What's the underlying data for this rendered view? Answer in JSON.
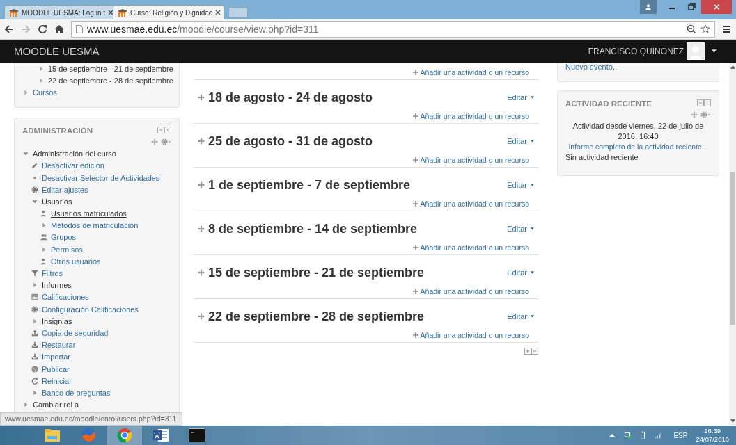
{
  "browser": {
    "tabs": [
      {
        "title": "MOODLE UESMA: Log in t",
        "selected": false
      },
      {
        "title": "Curso: Religión y Dignidac",
        "selected": true
      }
    ],
    "url_host": "www.uesmae.edu.ec",
    "url_path": "/moodle/course/view.php?id=311"
  },
  "navbar": {
    "brand": "MOODLE UESMA",
    "user": "FRANCISCO QUIÑONEZ"
  },
  "nav_block": {
    "weeks": [
      "15 de septiembre - 21 de septiembre",
      "22 de septiembre - 28 de septiembre"
    ],
    "courses_link": "Cursos"
  },
  "admin": {
    "title": "ADMINISTRACIÓN",
    "tree": [
      {
        "label": "Administración del curso",
        "kind": "branch",
        "link": false,
        "expanded": true,
        "children": [
          {
            "label": "Desactivar edición",
            "kind": "edit"
          },
          {
            "label": "Desactivar Selector de Actividades",
            "kind": "bullet"
          },
          {
            "label": "Editar ajustes",
            "kind": "settings"
          },
          {
            "label": "Usuarios",
            "kind": "branch",
            "link": false,
            "expanded": true,
            "children": [
              {
                "label": "Usuarios matriculados",
                "kind": "user",
                "selected": true
              },
              {
                "label": "Métodos de matriculación",
                "kind": "branch",
                "link": true,
                "expanded": false
              },
              {
                "label": "Grupos",
                "kind": "group",
                "selected": false
              },
              {
                "label": "Permisos",
                "kind": "branch",
                "link": true,
                "expanded": false
              },
              {
                "label": "Otros usuarios",
                "kind": "user",
                "selected": false
              }
            ]
          },
          {
            "label": "Filtros",
            "kind": "filter"
          },
          {
            "label": "Informes",
            "kind": "branch",
            "link": false,
            "expanded": false
          },
          {
            "label": "Calificaciones",
            "kind": "grades"
          },
          {
            "label": "Configuración Calificaciones",
            "kind": "settings"
          },
          {
            "label": "Insignias",
            "kind": "branch",
            "link": false,
            "expanded": false
          },
          {
            "label": "Copia de seguridad",
            "kind": "backup"
          },
          {
            "label": "Restaurar",
            "kind": "restore"
          },
          {
            "label": "Importar",
            "kind": "restore"
          },
          {
            "label": "Publicar",
            "kind": "publish"
          },
          {
            "label": "Reiniciar",
            "kind": "reset"
          },
          {
            "label": "Banco de preguntas",
            "kind": "branch",
            "link": true,
            "expanded": false
          }
        ]
      },
      {
        "label": "Cambiar rol a",
        "kind": "branch",
        "link": false,
        "expanded": false
      }
    ]
  },
  "course": {
    "top_add_link": "Añadir una actividad o un recurso",
    "sections": [
      {
        "title": "18 de agosto - 24 de agosto",
        "edit": "Editar",
        "add": "Añadir una actividad o un recurso"
      },
      {
        "title": "25 de agosto - 31 de agosto",
        "edit": "Editar",
        "add": "Añadir una actividad o un recurso"
      },
      {
        "title": "1 de septiembre - 7 de septiembre",
        "edit": "Editar",
        "add": "Añadir una actividad o un recurso"
      },
      {
        "title": "8 de septiembre - 14 de septiembre",
        "edit": "Editar",
        "add": "Añadir una actividad o un recurso"
      },
      {
        "title": "15 de septiembre - 21 de septiembre",
        "edit": "Editar",
        "add": "Añadir una actividad o un recurso"
      },
      {
        "title": "22 de septiembre - 28 de septiembre",
        "edit": "Editar",
        "add": "Añadir una actividad o un recurso"
      }
    ]
  },
  "calendar_block": {
    "new_event_link": "Nuevo evento..."
  },
  "recent": {
    "title": "ACTIVIDAD RECIENTE",
    "since": "Actividad desde viernes, 22 de julio de 2016, 16:40",
    "report_link": "Informe completo de la actividad reciente...",
    "empty": "Sin actividad reciente"
  },
  "status_url": "www.uesmae.edu.ec/moodle/enrol/users.php?id=311",
  "taskbar": {
    "apps": [
      {
        "kind": "folder",
        "selected": false
      },
      {
        "kind": "fox",
        "selected": false
      },
      {
        "kind": "globe",
        "selected": true
      },
      {
        "kind": "document",
        "selected": false
      },
      {
        "kind": "terminal",
        "selected": false
      }
    ],
    "language": "ESP",
    "time": "16:39",
    "date": "24/07/2016"
  }
}
